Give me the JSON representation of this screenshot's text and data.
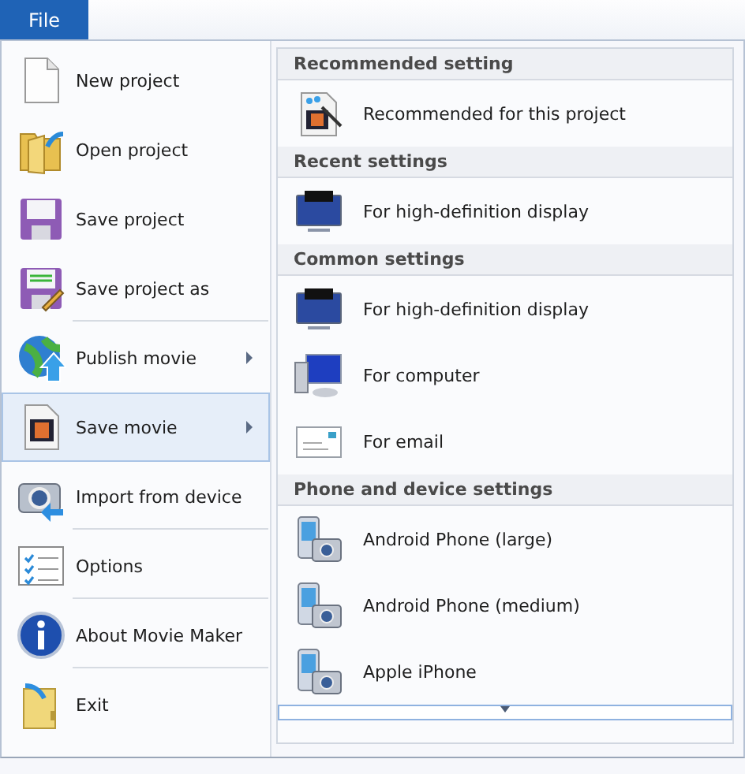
{
  "menu_tab": {
    "label": "File",
    "selected": true
  },
  "left_menu": [
    {
      "label": "New project",
      "submenu": false,
      "selected": false,
      "divider_after": false
    },
    {
      "label": "Open project",
      "submenu": false,
      "selected": false,
      "divider_after": false
    },
    {
      "label": "Save project",
      "submenu": false,
      "selected": false,
      "divider_after": false
    },
    {
      "label": "Save project as",
      "submenu": false,
      "selected": false,
      "divider_after": true
    },
    {
      "label": "Publish movie",
      "submenu": true,
      "selected": false,
      "divider_after": false
    },
    {
      "label": "Save movie",
      "submenu": true,
      "selected": true,
      "divider_after": false
    },
    {
      "label": "Import from device",
      "submenu": false,
      "selected": false,
      "divider_after": true
    },
    {
      "label": "Options",
      "submenu": false,
      "selected": false,
      "divider_after": true
    },
    {
      "label": "About Movie Maker",
      "submenu": false,
      "selected": false,
      "divider_after": true
    },
    {
      "label": "Exit",
      "submenu": false,
      "selected": false,
      "divider_after": false
    }
  ],
  "sections": [
    {
      "title": "Recommended setting",
      "items": [
        {
          "label": "Recommended for this project"
        }
      ]
    },
    {
      "title": "Recent settings",
      "items": [
        {
          "label": "For high-definition display"
        }
      ]
    },
    {
      "title": "Common settings",
      "items": [
        {
          "label": "For high-definition display"
        },
        {
          "label": "For computer"
        },
        {
          "label": "For email"
        }
      ]
    },
    {
      "title": "Phone and device settings",
      "items": [
        {
          "label": "Android Phone (large)"
        },
        {
          "label": "Android Phone (medium)"
        },
        {
          "label": "Apple iPhone"
        }
      ]
    }
  ]
}
